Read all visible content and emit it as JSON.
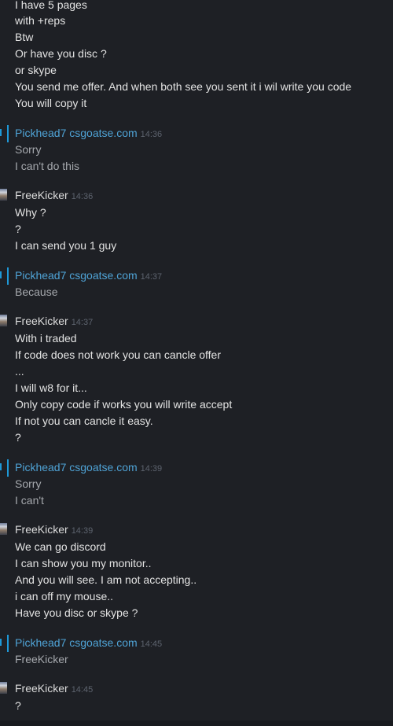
{
  "intro_lines": [
    "I have 5 pages",
    "with +reps",
    "Btw",
    "Or have you disc ?",
    "or skype",
    "You send me offer. And when both see you sent it i wil write you code",
    "You will copy it"
  ],
  "groups": [
    {
      "sender": "Pickhead7 csgoatse.com",
      "time": "14:36",
      "lines": [
        "Sorry",
        "I can't do this"
      ]
    },
    {
      "sender": "FreeKicker",
      "time": "14:36",
      "lines": [
        "Why ?",
        "?",
        "I can send you 1 guy"
      ]
    },
    {
      "sender": "Pickhead7 csgoatse.com",
      "time": "14:37",
      "lines": [
        "Because"
      ]
    },
    {
      "sender": "FreeKicker",
      "time": "14:37",
      "lines": [
        "With i traded",
        "If code does not work you can cancle offer",
        "...",
        "I will w8 for it...",
        "Only copy code if works you will write accept",
        "If not you can cancle it easy.",
        "?"
      ]
    },
    {
      "sender": "Pickhead7 csgoatse.com",
      "time": "14:39",
      "lines": [
        "Sorry",
        "I can't"
      ]
    },
    {
      "sender": "FreeKicker",
      "time": "14:39",
      "lines": [
        "We can go discord",
        "I can show you my monitor..",
        "And you will see. I am not accepting..",
        "i can off my mouse..",
        "Have you disc or skype ?"
      ]
    },
    {
      "sender": "Pickhead7 csgoatse.com",
      "time": "14:45",
      "lines": [
        "FreeKicker"
      ]
    },
    {
      "sender": "FreeKicker",
      "time": "14:45",
      "lines": [
        "?"
      ]
    }
  ],
  "colors": {
    "background": "#1e2025",
    "self_name": "#4fa3d6",
    "accent_bar": "#1e99d8",
    "timestamp": "#5d636e"
  }
}
